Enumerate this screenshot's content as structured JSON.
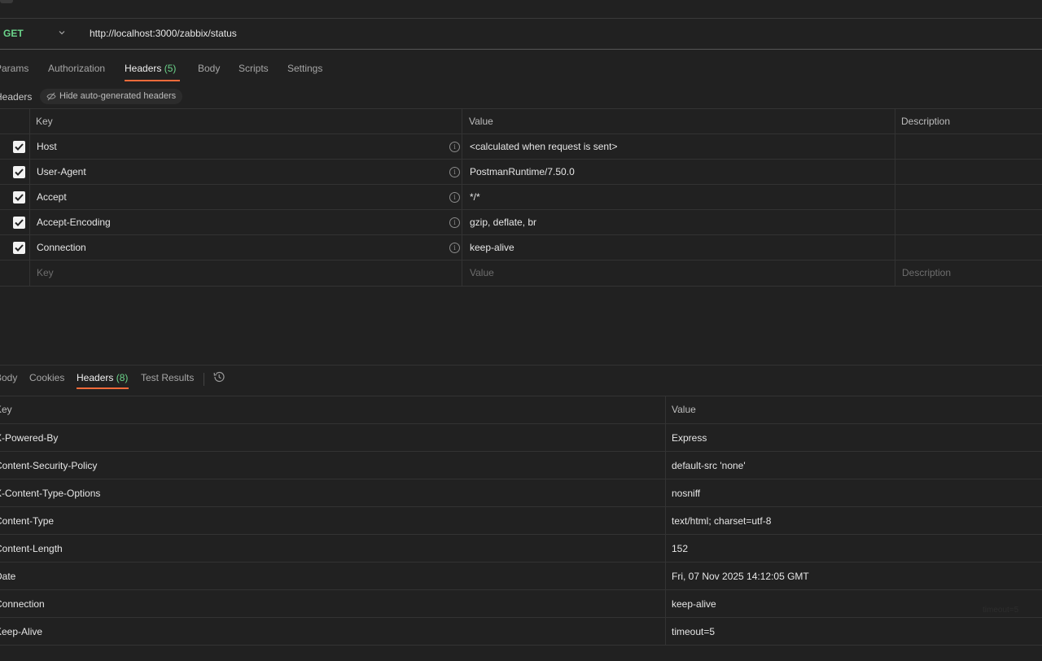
{
  "request": {
    "method": "GET",
    "url": "http://localhost:3000/zabbix/status"
  },
  "request_tabs": [
    {
      "label": "Params"
    },
    {
      "label": "Authorization"
    },
    {
      "label": "Headers",
      "count": "(5)"
    },
    {
      "label": "Body"
    },
    {
      "label": "Scripts"
    },
    {
      "label": "Settings"
    }
  ],
  "headers_section": {
    "label": "Headers",
    "hide_button": "Hide auto-generated headers"
  },
  "request_headers": {
    "columns": {
      "key": "Key",
      "value": "Value",
      "description": "Description"
    },
    "rows": [
      {
        "key": "Host",
        "value": "<calculated when request is sent>",
        "checked": true
      },
      {
        "key": "User-Agent",
        "value": "PostmanRuntime/7.50.0",
        "checked": true
      },
      {
        "key": "Accept",
        "value": "*/*",
        "checked": true
      },
      {
        "key": "Accept-Encoding",
        "value": "gzip, deflate, br",
        "checked": true
      },
      {
        "key": "Connection",
        "value": "keep-alive",
        "checked": true
      }
    ],
    "placeholder": {
      "key": "Key",
      "value": "Value",
      "description": "Description"
    }
  },
  "response_tabs": [
    {
      "label": "Body"
    },
    {
      "label": "Cookies"
    },
    {
      "label": "Headers",
      "count": "(8)"
    },
    {
      "label": "Test Results"
    }
  ],
  "response_headers": {
    "columns": {
      "key": "Key",
      "value": "Value"
    },
    "rows": [
      {
        "key": "X-Powered-By",
        "value": "Express"
      },
      {
        "key": "Content-Security-Policy",
        "value": "default-src 'none'"
      },
      {
        "key": "X-Content-Type-Options",
        "value": "nosniff"
      },
      {
        "key": "Content-Type",
        "value": "text/html; charset=utf-8"
      },
      {
        "key": "Content-Length",
        "value": "152"
      },
      {
        "key": "Date",
        "value": "Fri, 07 Nov 2025 14:12:05 GMT"
      },
      {
        "key": "Connection",
        "value": "keep-alive"
      },
      {
        "key": "Keep-Alive",
        "value": "timeout=5"
      }
    ]
  },
  "watermark": "timeout=5",
  "colors": {
    "accent": "#f26b3a",
    "method": "#6bd48a",
    "background": "#212121"
  }
}
